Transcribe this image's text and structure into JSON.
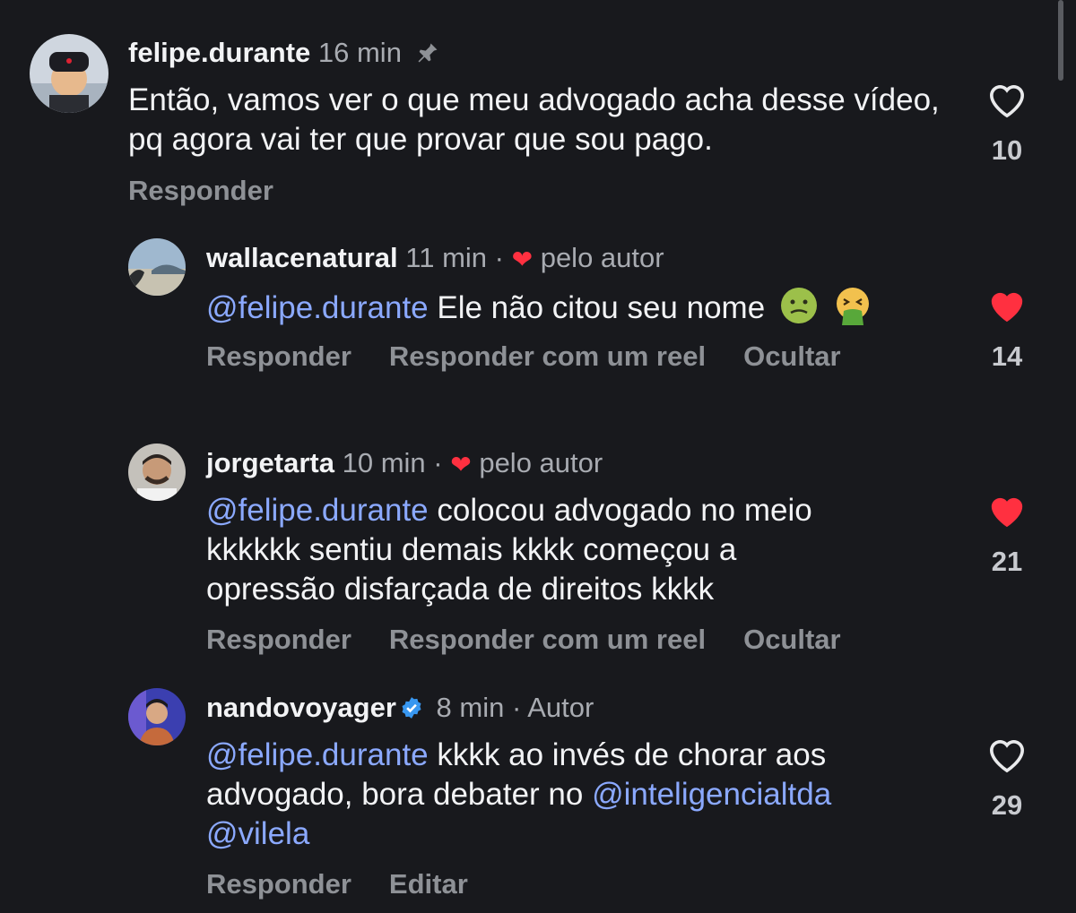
{
  "comments": [
    {
      "username": "felipe.durante",
      "time": "16 min",
      "text": "Então, vamos ver o que meu advogado acha desse vídeo, pq agora vai ter que provar que sou pago.",
      "actions": [
        "Responder"
      ],
      "likes": "10",
      "liked": false,
      "pinned": true
    },
    {
      "username": "wallacenatural",
      "time": "11 min",
      "separator": "·",
      "author_label": "pelo autor",
      "mention": "@felipe.durante",
      "text": "Ele não citou seu nome",
      "emojis": [
        "nauseated-face",
        "vomiting-face"
      ],
      "actions": [
        "Responder",
        "Responder com um reel",
        "Ocultar"
      ],
      "likes": "14",
      "liked": true
    },
    {
      "username": "jorgetarta",
      "time": "10 min",
      "separator": "·",
      "author_label": "pelo autor",
      "mention": "@felipe.durante",
      "text_line1": "colocou advogado no meio",
      "text_line2": "kkkkkk sentiu demais kkkk começou a",
      "text_line3": "opressão disfarçada de direitos kkkk",
      "actions": [
        "Responder",
        "Responder com um reel",
        "Ocultar"
      ],
      "likes": "21",
      "liked": true
    },
    {
      "username": "nandovoyager",
      "verified": true,
      "time": "8 min",
      "separator": "·",
      "author_label": "Autor",
      "mention": "@felipe.durante",
      "text_line1": "kkkk ao invés de chorar aos",
      "text_line2": "advogado, bora debater no",
      "mention2": "@inteligencialtda",
      "mention3": "@vilela",
      "actions": [
        "Responder",
        "Editar"
      ],
      "likes": "29",
      "liked": false
    }
  ],
  "colors": {
    "background": "#18191d",
    "mention": "#8ba9ff",
    "like_red": "#ff3040",
    "muted": "#a8abb1"
  }
}
